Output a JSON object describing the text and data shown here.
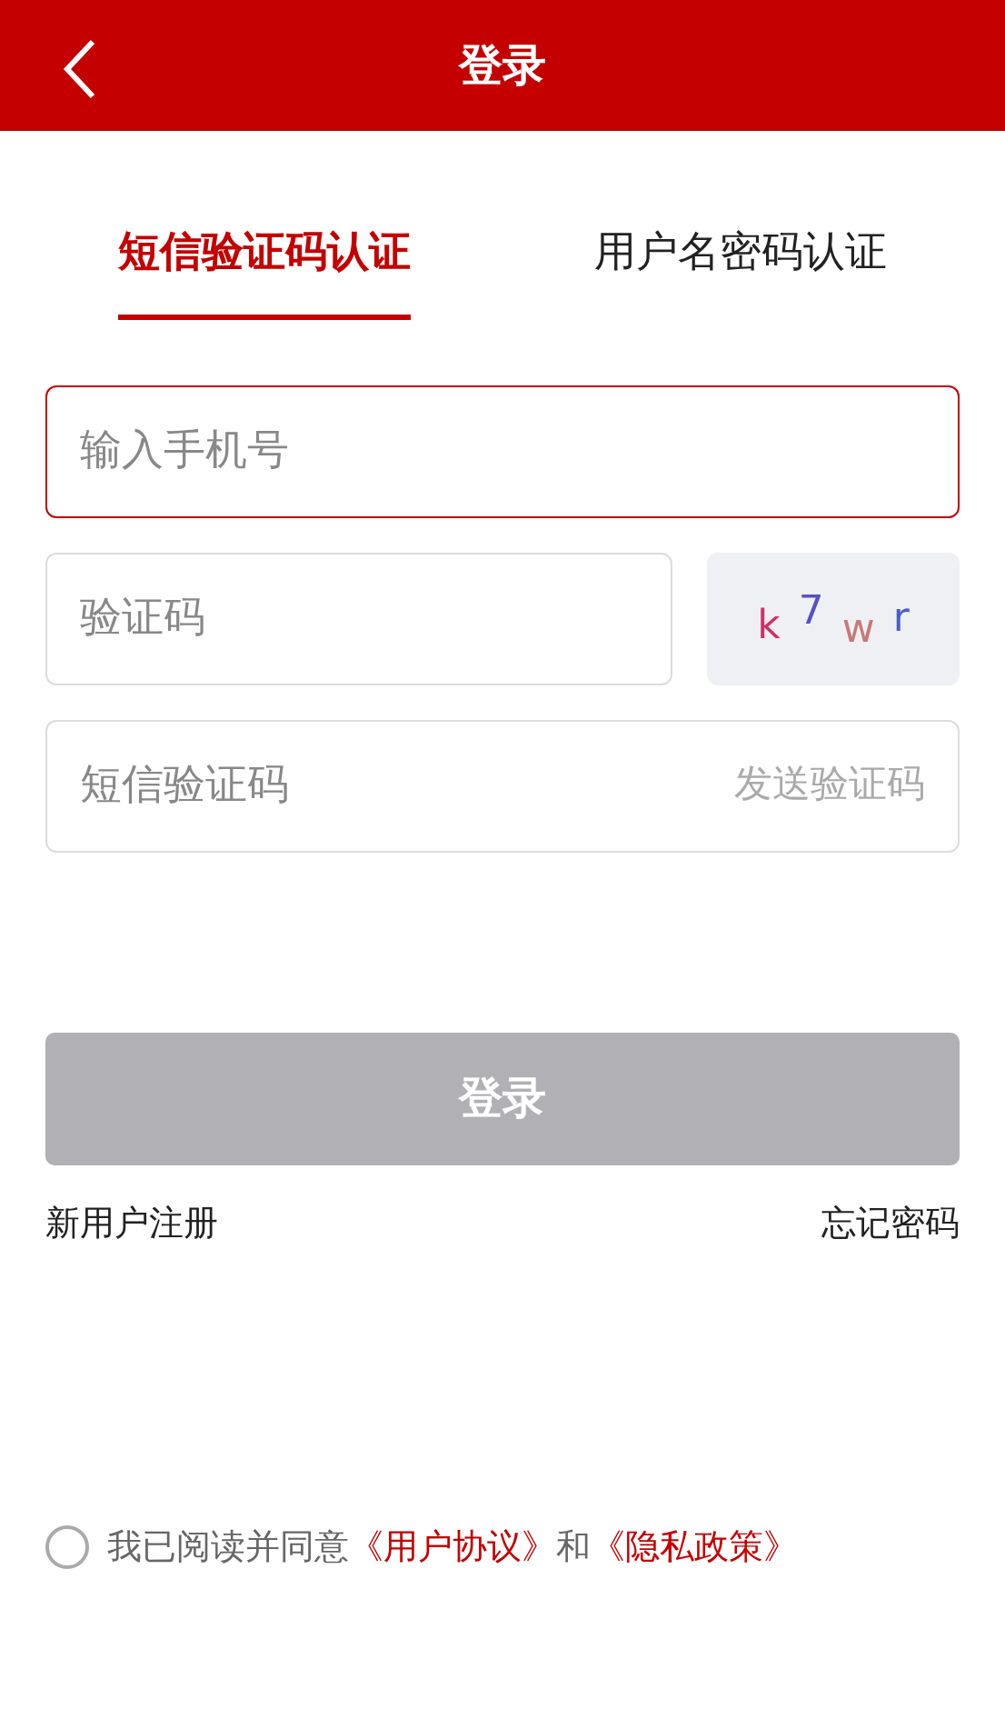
{
  "header": {
    "title": "登录"
  },
  "tabs": [
    {
      "label": "短信验证码认证",
      "selected": true
    },
    {
      "label": "用户名密码认证",
      "selected": false
    }
  ],
  "fields": [
    {
      "kind": "phone",
      "placeholder": "输入手机号",
      "focused": true
    },
    {
      "kind": "captcha",
      "placeholder": "验证码",
      "focused": false,
      "captcha": [
        {
          "char": "k",
          "color": "#d0306a"
        },
        {
          "char": "7",
          "color": "#5a4fc8"
        },
        {
          "char": "w",
          "color": "#c87878"
        },
        {
          "char": "r",
          "color": "#4a5ec8"
        }
      ]
    },
    {
      "kind": "sms",
      "placeholder": "短信验证码",
      "focused": false,
      "action": "发送验证码"
    }
  ],
  "login_button": {
    "label": "登录",
    "disabled": true
  },
  "links": {
    "register": "新用户注册",
    "forgot": "忘记密码"
  },
  "agreement": {
    "checked": false,
    "parts": [
      {
        "kind": "text",
        "text": "我已阅读并同意"
      },
      {
        "kind": "link",
        "text": "《用户协议》"
      },
      {
        "kind": "text",
        "text": "和"
      },
      {
        "kind": "link",
        "text": "《隐私政策》"
      }
    ]
  }
}
